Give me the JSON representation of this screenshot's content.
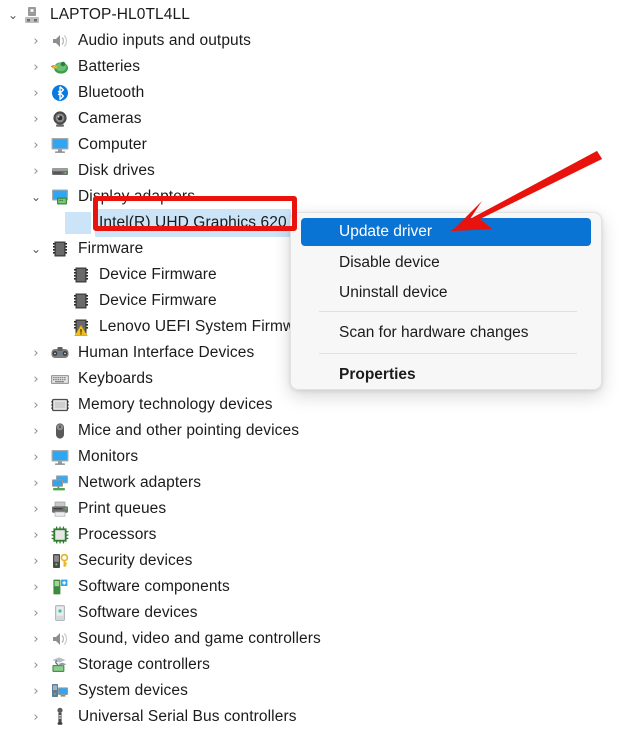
{
  "window": {
    "app": "Device Manager",
    "background_color": "#ffffff"
  },
  "tree": {
    "root": {
      "label": "LAPTOP-HL0TL4LL",
      "icon": "computer-root-icon",
      "expanded": true,
      "expander": "chevron-down-icon"
    },
    "nodes": [
      {
        "label": "Audio inputs and outputs",
        "icon": "speaker-icon",
        "level": 1,
        "expanded": false,
        "expander": "chevron-right-icon"
      },
      {
        "label": "Batteries",
        "icon": "battery-icon",
        "level": 1,
        "expanded": false,
        "expander": "chevron-right-icon"
      },
      {
        "label": "Bluetooth",
        "icon": "bluetooth-icon",
        "level": 1,
        "expanded": false,
        "expander": "chevron-right-icon"
      },
      {
        "label": "Cameras",
        "icon": "camera-icon",
        "level": 1,
        "expanded": false,
        "expander": "chevron-right-icon"
      },
      {
        "label": "Computer",
        "icon": "monitor-icon",
        "level": 1,
        "expanded": false,
        "expander": "chevron-right-icon"
      },
      {
        "label": "Disk drives",
        "icon": "disk-drive-icon",
        "level": 1,
        "expanded": false,
        "expander": "chevron-right-icon"
      },
      {
        "label": "Display adapters",
        "icon": "display-adapter-icon",
        "level": 1,
        "expanded": true,
        "expander": "chevron-down-icon"
      },
      {
        "label": "Intel(R) UHD Graphics 620",
        "icon": "display-adapter-icon",
        "level": 2,
        "expanded": false,
        "expander": "none",
        "selected": true
      },
      {
        "label": "Firmware",
        "icon": "firmware-chip-icon",
        "level": 1,
        "expanded": true,
        "expander": "chevron-down-icon"
      },
      {
        "label": "Device Firmware",
        "icon": "firmware-chip-icon",
        "level": 2,
        "expanded": false,
        "expander": "none"
      },
      {
        "label": "Device Firmware",
        "icon": "firmware-chip-icon",
        "level": 2,
        "expanded": false,
        "expander": "none"
      },
      {
        "label": "Lenovo UEFI System Firmw",
        "icon": "firmware-chip-warning-icon",
        "level": 2,
        "expanded": false,
        "expander": "none",
        "truncated": true
      },
      {
        "label": "Human Interface Devices",
        "icon": "hid-gamepad-icon",
        "level": 1,
        "expanded": false,
        "expander": "chevron-right-icon"
      },
      {
        "label": "Keyboards",
        "icon": "keyboard-icon",
        "level": 1,
        "expanded": false,
        "expander": "chevron-right-icon"
      },
      {
        "label": "Memory technology devices",
        "icon": "memory-technology-icon",
        "level": 1,
        "expanded": false,
        "expander": "chevron-right-icon"
      },
      {
        "label": "Mice and other pointing devices",
        "icon": "mouse-icon",
        "level": 1,
        "expanded": false,
        "expander": "chevron-right-icon"
      },
      {
        "label": "Monitors",
        "icon": "monitor-icon",
        "level": 1,
        "expanded": false,
        "expander": "chevron-right-icon"
      },
      {
        "label": "Network adapters",
        "icon": "network-adapter-icon",
        "level": 1,
        "expanded": false,
        "expander": "chevron-right-icon"
      },
      {
        "label": "Print queues",
        "icon": "printer-icon",
        "level": 1,
        "expanded": false,
        "expander": "chevron-right-icon"
      },
      {
        "label": "Processors",
        "icon": "processor-icon",
        "level": 1,
        "expanded": false,
        "expander": "chevron-right-icon"
      },
      {
        "label": "Security devices",
        "icon": "security-key-icon",
        "level": 1,
        "expanded": false,
        "expander": "chevron-right-icon"
      },
      {
        "label": "Software components",
        "icon": "software-component-icon",
        "level": 1,
        "expanded": false,
        "expander": "chevron-right-icon"
      },
      {
        "label": "Software devices",
        "icon": "software-device-icon",
        "level": 1,
        "expanded": false,
        "expander": "chevron-right-icon"
      },
      {
        "label": "Sound, video and game controllers",
        "icon": "speaker-icon",
        "level": 1,
        "expanded": false,
        "expander": "chevron-right-icon"
      },
      {
        "label": "Storage controllers",
        "icon": "storage-controller-icon",
        "level": 1,
        "expanded": false,
        "expander": "chevron-right-icon"
      },
      {
        "label": "System devices",
        "icon": "system-device-icon",
        "level": 1,
        "expanded": false,
        "expander": "chevron-right-icon"
      },
      {
        "label": "Universal Serial Bus controllers",
        "icon": "usb-icon",
        "level": 1,
        "expanded": false,
        "expander": "chevron-right-icon"
      }
    ]
  },
  "context_menu": {
    "items": [
      {
        "label": "Update driver",
        "highlighted": true,
        "bold": false
      },
      {
        "label": "Disable device",
        "highlighted": false,
        "bold": false
      },
      {
        "label": "Uninstall device",
        "highlighted": false,
        "bold": false
      },
      {
        "label": "Scan for hardware changes",
        "highlighted": false,
        "bold": false
      },
      {
        "label": "Properties",
        "highlighted": false,
        "bold": true
      }
    ],
    "highlight_color": "#0a74d4",
    "background_color": "#f7f7f7"
  },
  "annotations": {
    "highlight_box": {
      "name": "red-rectangle-annotation",
      "color": "#e8130c"
    },
    "arrow": {
      "name": "red-arrow-annotation",
      "color": "#e8130c",
      "points_to": "Update driver"
    }
  }
}
